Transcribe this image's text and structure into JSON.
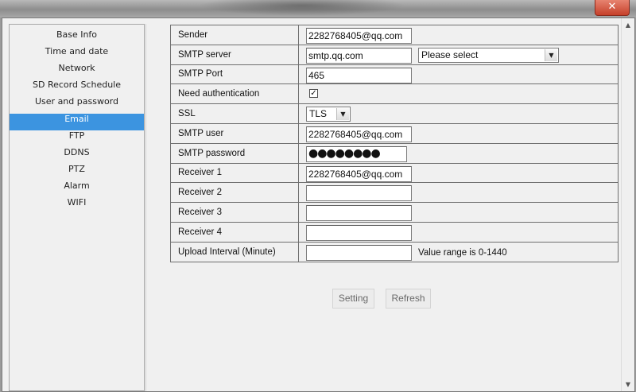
{
  "window": {
    "close_label": "✕"
  },
  "sidebar": {
    "items": [
      {
        "label": "Base Info"
      },
      {
        "label": "Time and date"
      },
      {
        "label": "Network"
      },
      {
        "label": "SD Record Schedule"
      },
      {
        "label": "User and password"
      },
      {
        "label": "Email"
      },
      {
        "label": "FTP"
      },
      {
        "label": "DDNS"
      },
      {
        "label": "PTZ"
      },
      {
        "label": "Alarm"
      },
      {
        "label": "WIFI"
      }
    ],
    "active": "Email"
  },
  "form": {
    "sender": {
      "label": "Sender",
      "value": "2282768405@qq.com"
    },
    "smtp_server": {
      "label": "SMTP server",
      "value": "smtp.qq.com",
      "select": "Please select"
    },
    "smtp_port": {
      "label": "SMTP Port",
      "value": "465"
    },
    "need_auth": {
      "label": "Need authentication",
      "checked": true,
      "mark": "✓"
    },
    "ssl": {
      "label": "SSL",
      "value": "TLS"
    },
    "smtp_user": {
      "label": "SMTP user",
      "value": "2282768405@qq.com"
    },
    "smtp_password": {
      "label": "SMTP password",
      "value": "●●●●●●●●"
    },
    "receiver1": {
      "label": "Receiver 1",
      "value": "2282768405@qq.com"
    },
    "receiver2": {
      "label": "Receiver 2",
      "value": ""
    },
    "receiver3": {
      "label": "Receiver 3",
      "value": ""
    },
    "receiver4": {
      "label": "Receiver 4",
      "value": ""
    },
    "upload_interval": {
      "label": "Upload Interval (Minute)",
      "value": "",
      "hint": "Value range is 0-1440"
    }
  },
  "buttons": {
    "setting": "Setting",
    "refresh": "Refresh"
  },
  "icons": {
    "dropdown": "chevron-down-icon",
    "close": "close-icon",
    "check": "check-icon"
  },
  "colors": {
    "selected_item": "#3c94e0",
    "close_button": "#c5402a"
  }
}
